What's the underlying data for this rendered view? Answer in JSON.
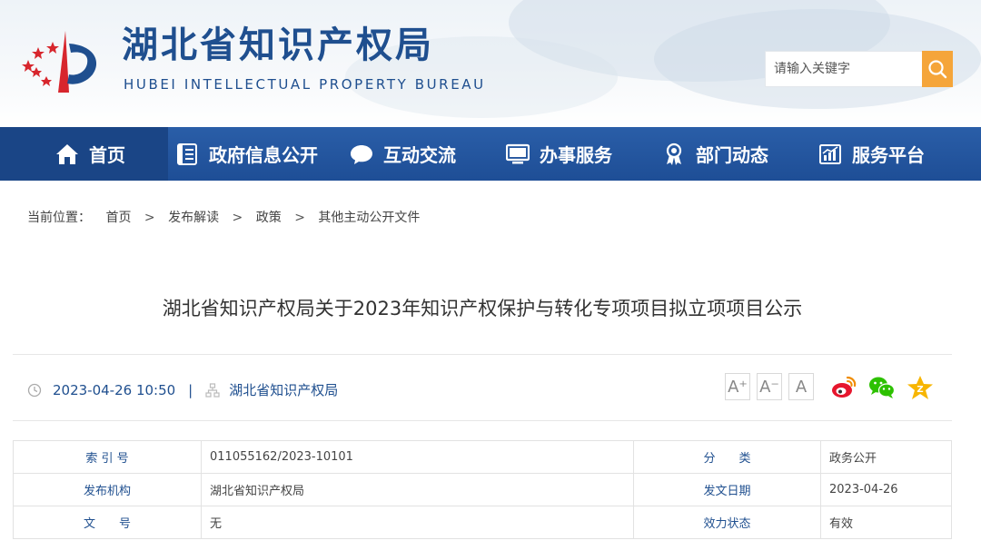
{
  "header": {
    "title_cn": "湖北省知识产权局",
    "title_en": "HUBEI INTELLECTUAL PROPERTY BUREAU",
    "search_placeholder": "请输入关键字",
    "colors": {
      "brand_blue": "#1f4f8f",
      "accent_orange": "#f5a53a",
      "emblem_red": "#d7262d"
    }
  },
  "nav": {
    "items": [
      {
        "label": "首页",
        "icon": "home-icon"
      },
      {
        "label": "政府信息公开",
        "icon": "document-list-icon"
      },
      {
        "label": "互动交流",
        "icon": "chat-bubble-icon"
      },
      {
        "label": "办事服务",
        "icon": "monitor-icon"
      },
      {
        "label": "部门动态",
        "icon": "award-icon"
      },
      {
        "label": "服务平台",
        "icon": "chart-icon"
      }
    ]
  },
  "breadcrumb": {
    "prefix": "当前位置：",
    "items": [
      "首页",
      "发布解读",
      "政策",
      "其他主动公开文件"
    ],
    "separator": ">"
  },
  "article": {
    "title": "湖北省知识产权局关于2023年知识产权保护与转化专项项目拟立项项目公示",
    "datetime": "2023-04-26 10:50",
    "meta_separator": "|",
    "source": "湖北省知识产权局",
    "font_size_buttons": [
      "A⁺",
      "A⁻",
      "A"
    ],
    "share_icons": [
      "weibo-icon",
      "wechat-icon",
      "qzone-icon"
    ]
  },
  "info_table": {
    "rows": [
      {
        "label1": "索 引 号",
        "value1": "011055162/2023-10101",
        "label2": "分　　类",
        "value2": "政务公开"
      },
      {
        "label1": "发布机构",
        "value1": "湖北省知识产权局",
        "label2": "发文日期",
        "value2": "2023-04-26"
      },
      {
        "label1": "文　　号",
        "value1": "无",
        "label2": "效力状态",
        "value2": "有效"
      }
    ]
  }
}
